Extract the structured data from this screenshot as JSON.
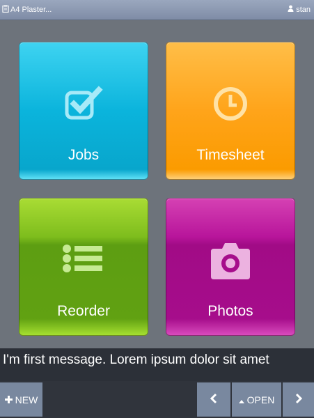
{
  "header": {
    "app_title": "A4 Plaster...",
    "user_name": "stan",
    "app_icon": "clipboard-icon",
    "user_icon": "user-icon"
  },
  "tiles": [
    {
      "label": "Jobs",
      "icon": "checkbox-icon",
      "color": "#0bb4dc"
    },
    {
      "label": "Timesheet",
      "icon": "clock-icon",
      "color": "#ffa41a"
    },
    {
      "label": "Reorder",
      "icon": "list-icon",
      "color": "#61a112"
    },
    {
      "label": "Photos",
      "icon": "camera-icon",
      "color": "#a60d8b"
    }
  ],
  "message": {
    "text": "I'm first message. Lorem ipsum dolor sit amet"
  },
  "toolbar": {
    "new_label": "NEW",
    "open_label": "OPEN",
    "new_icon": "plus-icon",
    "open_icon": "caret-up-icon",
    "prev_icon": "chevron-left-icon",
    "next_icon": "chevron-right-icon",
    "button_color": "#79889f"
  }
}
